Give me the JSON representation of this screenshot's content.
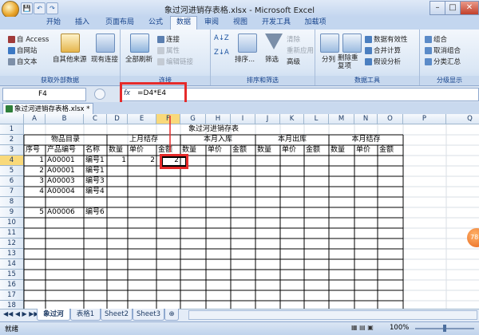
{
  "window": {
    "title": "象过河进销存表格.xlsx - Microsoft Excel",
    "minimize": "–",
    "maximize": "□",
    "close": "✕"
  },
  "quick_access": {
    "save": "💾",
    "undo": "↶",
    "redo": "↷"
  },
  "ribbon_tabs": [
    "开始",
    "插入",
    "页面布局",
    "公式",
    "数据",
    "审阅",
    "视图",
    "开发工具",
    "加载项"
  ],
  "active_tab": "数据",
  "ribbon": {
    "get_external": {
      "access": "自 Access",
      "web": "自网站",
      "text": "自文本",
      "other": "自其他来源",
      "existing": "现有连接",
      "label": "获取外部数据"
    },
    "connections": {
      "refresh_all": "全部刷新",
      "connect": "连接",
      "properties": "属性",
      "edit_links": "编辑链接",
      "label": "连接"
    },
    "sort_filter": {
      "sort_asc": "A↓Z",
      "sort_desc": "Z↓A",
      "sort": "排序...",
      "filter": "筛选",
      "clear": "清除",
      "reapply": "重新应用",
      "advanced": "高级",
      "label": "排序和筛选"
    },
    "data_tools": {
      "text_to_columns": "分列",
      "remove_duplicates": "删除重复项",
      "validation": "数据有效性",
      "consolidate": "合并计算",
      "what_if": "假设分析",
      "label": "数据工具"
    },
    "outline": {
      "group": "组合",
      "ungroup": "取消组合",
      "subtotal": "分类汇总",
      "label": "分级显示"
    }
  },
  "formula_bar": {
    "name_box": "F4",
    "fx": "fx",
    "formula": "=D4*E4"
  },
  "workbook_tab": "象过河进销存表格.xlsx *",
  "columns": [
    "A",
    "B",
    "C",
    "D",
    "E",
    "F",
    "G",
    "H",
    "I",
    "J",
    "K",
    "L",
    "M",
    "N",
    "O",
    "P",
    "Q"
  ],
  "rows": [
    "1",
    "2",
    "3",
    "4",
    "5",
    "6",
    "7",
    "8",
    "9",
    "10",
    "11",
    "12",
    "13",
    "14",
    "15",
    "16",
    "17",
    "18",
    "19"
  ],
  "sheet": {
    "title": "象过河进销存表",
    "group_headers": [
      "物品目录",
      "上月结存",
      "本月入库",
      "本月出库",
      "本月结存"
    ],
    "sub_headers": [
      "序号",
      "产品编号",
      "名称",
      "数量",
      "单价",
      "金额",
      "数量",
      "单价",
      "金额",
      "数量",
      "单价",
      "金额",
      "数量",
      "单价",
      "金额"
    ],
    "data_rows": [
      {
        "row": "4",
        "seq": "1",
        "code": "A00001",
        "name": "编号1",
        "qty": "1",
        "price": "2",
        "amount": "2"
      },
      {
        "row": "5",
        "seq": "2",
        "code": "A00001",
        "name": "编号1",
        "qty": "",
        "price": "",
        "amount": ""
      },
      {
        "row": "6",
        "seq": "3",
        "code": "A00003",
        "name": "编号3",
        "qty": "",
        "price": "",
        "amount": ""
      },
      {
        "row": "7",
        "seq": "4",
        "code": "A00004",
        "name": "编号4",
        "qty": "",
        "price": "",
        "amount": ""
      },
      {
        "row": "9",
        "seq": "5",
        "code": "A00006",
        "name": "编号6",
        "qty": "",
        "price": "",
        "amount": ""
      }
    ]
  },
  "sheet_tabs": [
    "象过河",
    "表格1",
    "Sheet2",
    "Sheet3"
  ],
  "active_sheet": "象过河",
  "status": {
    "ready": "就绪",
    "zoom": "100%"
  },
  "side_badge": "78"
}
